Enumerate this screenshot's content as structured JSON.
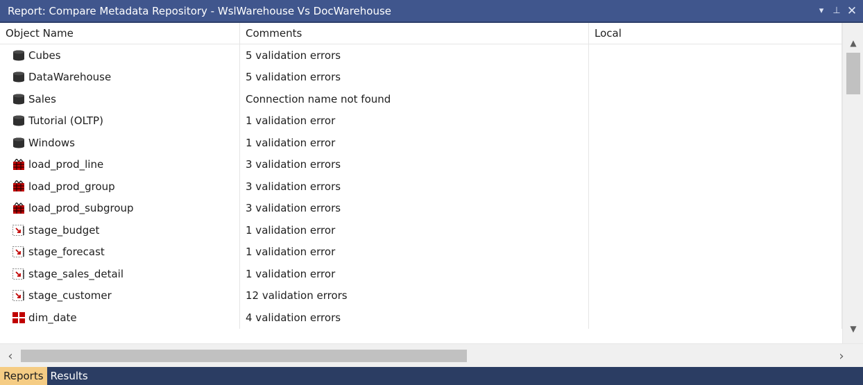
{
  "window": {
    "title": "Report: Compare Metadata Repository - WslWarehouse Vs DocWarehouse",
    "pin_glyph": "▾ ⊥",
    "close_glyph": "✕"
  },
  "columns": [
    "Object Name",
    "Comments",
    "Local"
  ],
  "rows": [
    {
      "name": "Cubes",
      "comment": "5 validation errors",
      "local": "",
      "icon": "database-icon"
    },
    {
      "name": "DataWarehouse",
      "comment": "5 validation errors",
      "local": "",
      "icon": "database-icon"
    },
    {
      "name": "Sales",
      "comment": "Connection name not found",
      "local": "",
      "icon": "database-icon"
    },
    {
      "name": "Tutorial (OLTP)",
      "comment": "1 validation error",
      "local": "",
      "icon": "database-icon"
    },
    {
      "name": "Windows",
      "comment": "1 validation error",
      "local": "",
      "icon": "database-icon"
    },
    {
      "name": "load_prod_line",
      "comment": "3 validation errors",
      "local": "",
      "icon": "load-table-icon"
    },
    {
      "name": "load_prod_group",
      "comment": "3 validation errors",
      "local": "",
      "icon": "load-table-icon"
    },
    {
      "name": "load_prod_subgroup",
      "comment": "3 validation errors",
      "local": "",
      "icon": "load-table-icon"
    },
    {
      "name": "stage_budget",
      "comment": "1 validation error",
      "local": "",
      "icon": "stage-table-icon"
    },
    {
      "name": "stage_forecast",
      "comment": "1 validation error",
      "local": "",
      "icon": "stage-table-icon"
    },
    {
      "name": "stage_sales_detail",
      "comment": "1 validation error",
      "local": "",
      "icon": "stage-table-icon"
    },
    {
      "name": "stage_customer",
      "comment": "12 validation errors",
      "local": "",
      "icon": "stage-table-icon"
    },
    {
      "name": "dim_date",
      "comment": "4 validation errors",
      "local": "",
      "icon": "dimension-table-icon"
    }
  ],
  "tabs": [
    {
      "label": "Reports",
      "active": true
    },
    {
      "label": "Results",
      "active": false
    }
  ],
  "colors": {
    "title_bar": "#40568d",
    "tab_bar": "#2b3d63",
    "active_tab": "#f5cc84",
    "load_icon": "#c00000"
  }
}
